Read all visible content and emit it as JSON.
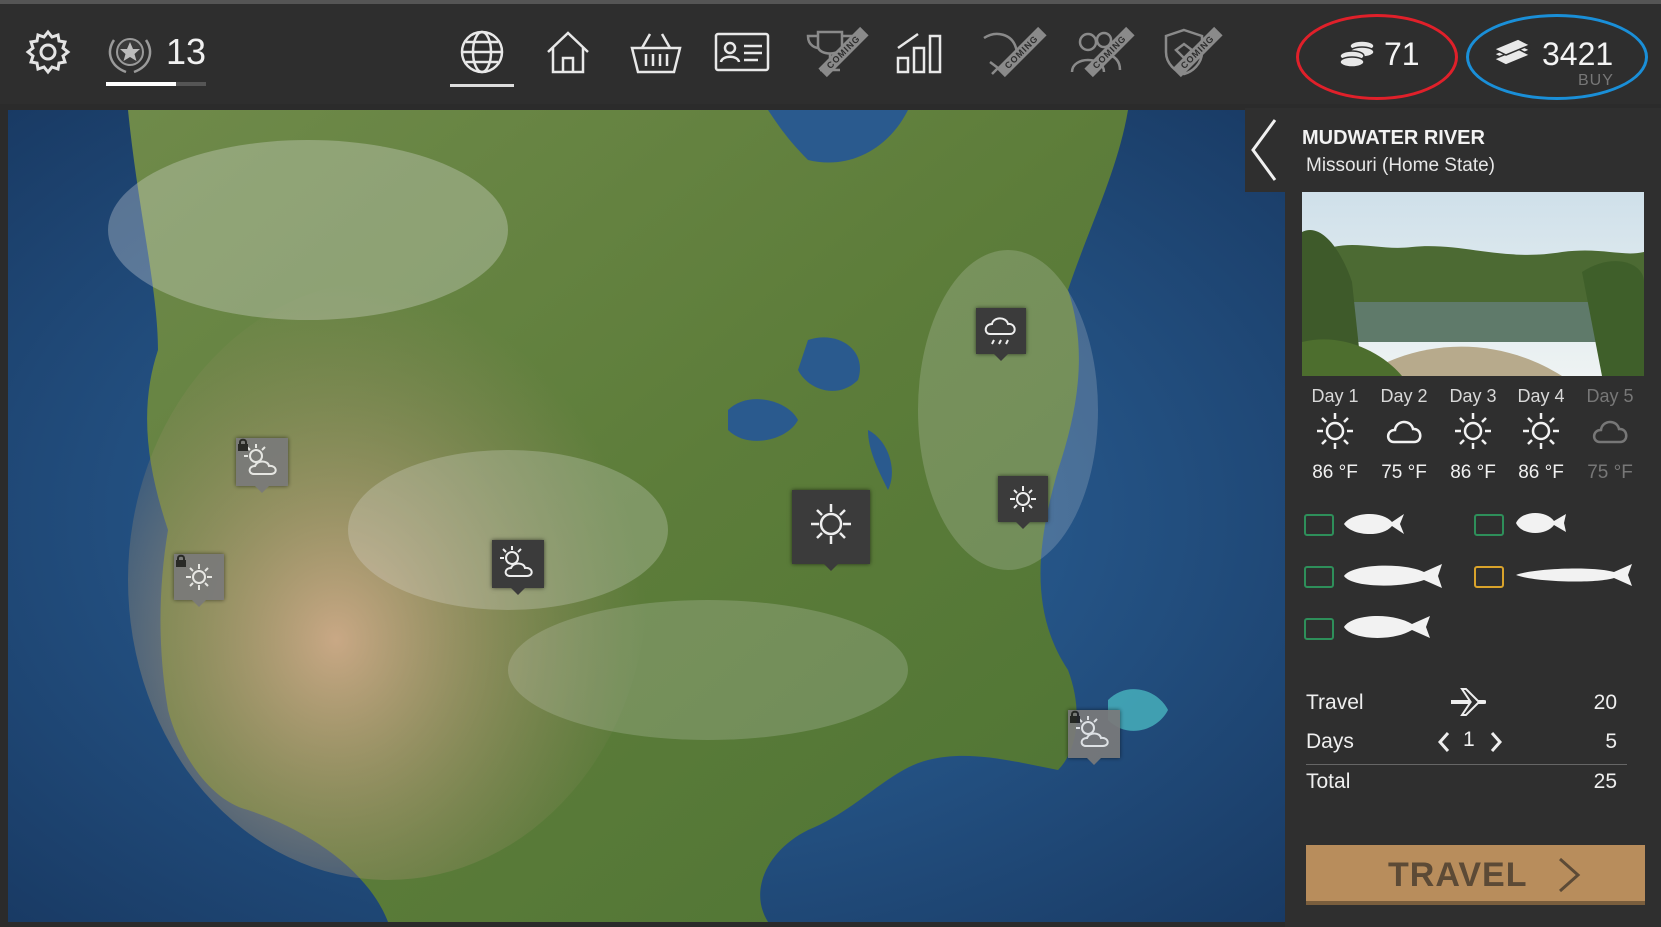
{
  "header": {
    "rank": "13",
    "rank_progress": 0.7,
    "coins": "71",
    "cash": "3421",
    "buy_label": "BUY",
    "coming_label": "COMING",
    "nav": [
      {
        "icon": "globe-icon",
        "active": true
      },
      {
        "icon": "home-icon"
      },
      {
        "icon": "shop-basket-icon"
      },
      {
        "icon": "license-card-icon"
      },
      {
        "icon": "trophy-icon",
        "coming": true
      },
      {
        "icon": "stats-chart-icon"
      },
      {
        "icon": "fishing-icon",
        "coming": true
      },
      {
        "icon": "friends-icon",
        "coming": true
      },
      {
        "icon": "clan-shield-icon",
        "coming": true
      }
    ],
    "highlight_colors": {
      "coins": "#e0202a",
      "cash": "#1a8fd8"
    }
  },
  "location": {
    "name": "MUDWATER RIVER",
    "state": "Missouri (Home State)"
  },
  "forecast": [
    {
      "label": "Day 1",
      "icon": "sun-icon",
      "temp": "86 °F",
      "dim": false
    },
    {
      "label": "Day 2",
      "icon": "cloud-icon",
      "temp": "75 °F",
      "dim": false
    },
    {
      "label": "Day 3",
      "icon": "sun-icon",
      "temp": "86 °F",
      "dim": false
    },
    {
      "label": "Day 4",
      "icon": "sun-icon",
      "temp": "86 °F",
      "dim": false
    },
    {
      "label": "Day 5",
      "icon": "cloud-icon",
      "temp": "75 °F",
      "dim": true
    }
  ],
  "trip": {
    "travel_label": "Travel",
    "travel_cost": "20",
    "days_label": "Days",
    "days_value": "1",
    "days_cost": "5",
    "total_label": "Total",
    "total_cost": "25",
    "button_label": "TRAVEL"
  },
  "colors": {
    "license_green": "#2e8f5a",
    "license_gold": "#d9a32b",
    "travel_button": "#b88d5c"
  }
}
